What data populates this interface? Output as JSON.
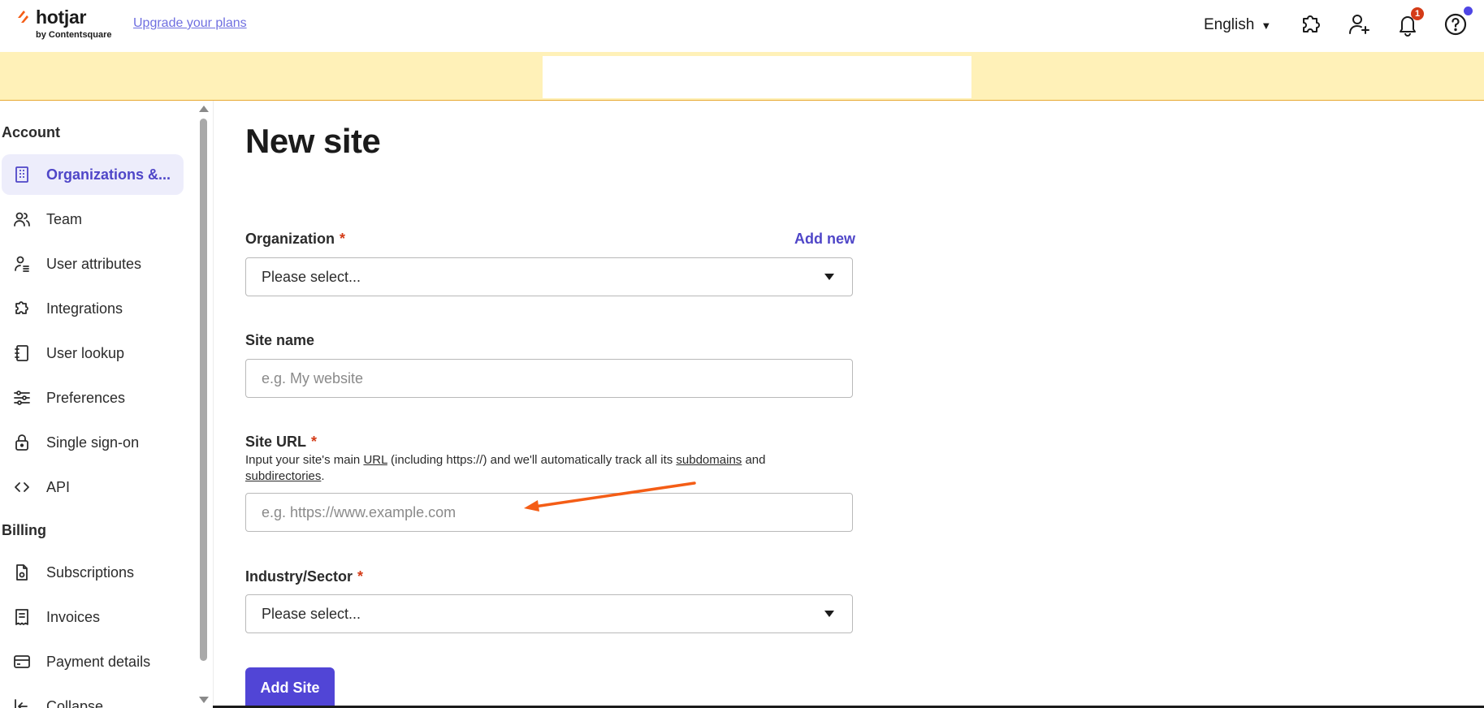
{
  "header": {
    "logo_text": "hotjar",
    "logo_sub": "by Contentsquare",
    "upgrade_link": "Upgrade your plans",
    "language": "English",
    "notification_count": "1",
    "icons": [
      "puzzle-icon",
      "add-user-icon",
      "bell-icon",
      "help-icon"
    ]
  },
  "sidebar": {
    "account_heading": "Account",
    "account_items": [
      {
        "label": "Organizations &...",
        "icon": "building-icon",
        "active": true
      },
      {
        "label": "Team",
        "icon": "team-icon"
      },
      {
        "label": "User attributes",
        "icon": "user-attributes-icon"
      },
      {
        "label": "Integrations",
        "icon": "puzzle-icon"
      },
      {
        "label": "User lookup",
        "icon": "notebook-icon"
      },
      {
        "label": "Preferences",
        "icon": "sliders-icon"
      },
      {
        "label": "Single sign-on",
        "icon": "lock-icon"
      },
      {
        "label": "API",
        "icon": "code-icon"
      }
    ],
    "billing_heading": "Billing",
    "billing_items": [
      {
        "label": "Subscriptions",
        "icon": "document-icon"
      },
      {
        "label": "Invoices",
        "icon": "receipt-icon"
      },
      {
        "label": "Payment details",
        "icon": "credit-card-icon"
      },
      {
        "label": "Collapse",
        "icon": "collapse-icon"
      }
    ]
  },
  "main": {
    "title": "New site",
    "organization": {
      "label": "Organization",
      "required": "*",
      "add_new": "Add new",
      "value": "Please select..."
    },
    "site_name": {
      "label": "Site name",
      "placeholder": "e.g. My website",
      "value": ""
    },
    "site_url": {
      "label": "Site URL",
      "required": "*",
      "help_1": "Input your site's main ",
      "help_url": "URL",
      "help_2": " (including https://) and we'll automatically track all its ",
      "help_subdomains": "subdomains",
      "help_3": " and ",
      "help_subdirectories": "subdirectories",
      "help_4": ".",
      "placeholder": "e.g. https://www.example.com",
      "value": ""
    },
    "industry": {
      "label": "Industry/Sector",
      "required": "*",
      "value": "Please select..."
    },
    "submit_label": "Add Site"
  },
  "colors": {
    "accent": "#5145d6",
    "link": "#4f46c8",
    "required": "#d43b17",
    "banner": "#fff1b8",
    "annotation_arrow": "#f45d16"
  }
}
